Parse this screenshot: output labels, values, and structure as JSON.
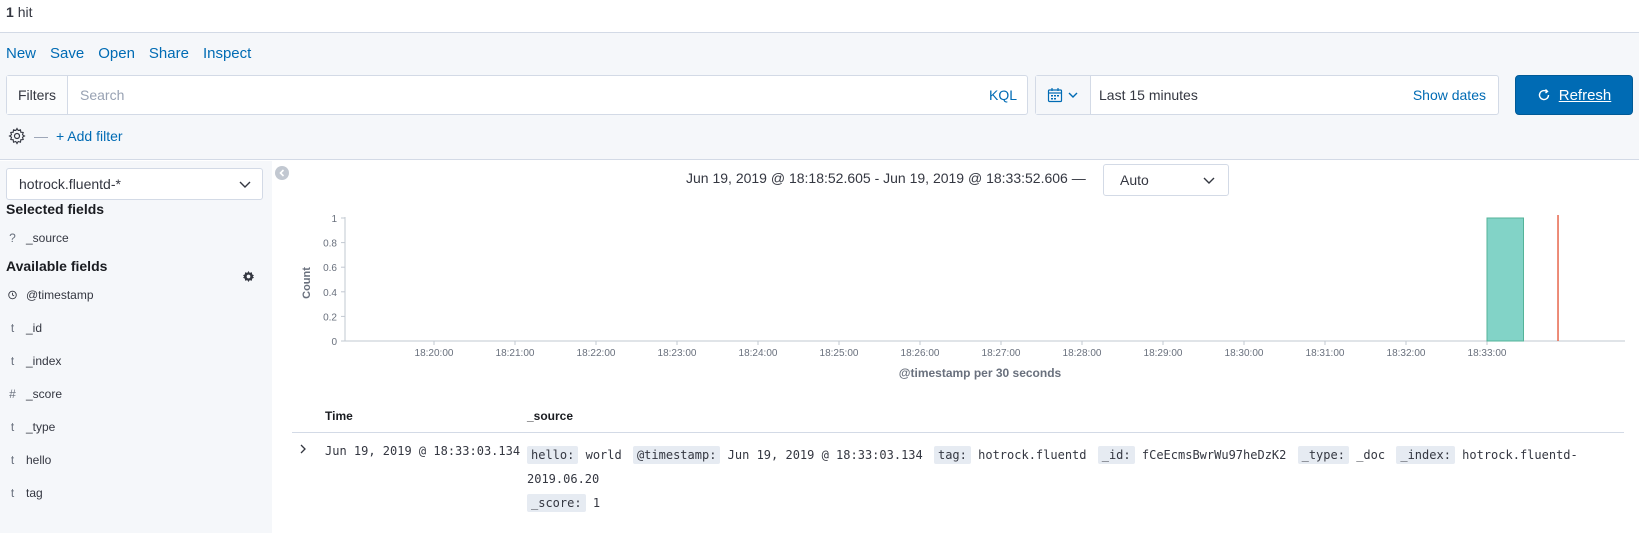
{
  "hits": {
    "count": "1",
    "label": "hit"
  },
  "menu": [
    "New",
    "Save",
    "Open",
    "Share",
    "Inspect"
  ],
  "query": {
    "filters_label": "Filters",
    "placeholder": "Search",
    "language": "KQL"
  },
  "time": {
    "label": "Last 15 minutes",
    "show_dates": "Show dates",
    "refresh": "Refresh"
  },
  "filter_bar": {
    "add_filter": "+ Add filter"
  },
  "sidebar": {
    "index_pattern": "hotrock.fluentd-*",
    "selected_title": "Selected fields",
    "selected_fields": [
      {
        "type": "?",
        "name": "_source"
      }
    ],
    "available_title": "Available fields",
    "available_fields": [
      {
        "type": "clock",
        "name": "@timestamp"
      },
      {
        "type": "t",
        "name": "_id"
      },
      {
        "type": "t",
        "name": "_index"
      },
      {
        "type": "#",
        "name": "_score"
      },
      {
        "type": "t",
        "name": "_type"
      },
      {
        "type": "t",
        "name": "hello"
      },
      {
        "type": "t",
        "name": "tag"
      }
    ]
  },
  "histogram": {
    "range_text": "Jun 19, 2019 @ 18:18:52.605 - Jun 19, 2019 @ 18:33:52.606 —",
    "interval": "Auto"
  },
  "chart_data": {
    "type": "bar",
    "xlabel": "@timestamp per 30 seconds",
    "ylabel": "Count",
    "ylim": [
      0,
      1
    ],
    "yticks": [
      "0",
      "0.2",
      "0.4",
      "0.6",
      "0.8",
      "1"
    ],
    "xticks": [
      "18:20:00",
      "18:21:00",
      "18:22:00",
      "18:23:00",
      "18:24:00",
      "18:25:00",
      "18:26:00",
      "18:27:00",
      "18:28:00",
      "18:29:00",
      "18:30:00",
      "18:31:00",
      "18:32:00",
      "18:33:00"
    ],
    "bars": [
      {
        "x": "18:33:00",
        "value": 1
      }
    ],
    "color": "#82d3c7",
    "now_marker_color": "#e7664c"
  },
  "table": {
    "headers": [
      "Time",
      "_source"
    ],
    "rows": [
      {
        "time": "Jun 19, 2019 @ 18:33:03.134",
        "source": [
          {
            "k": "hello:",
            "v": "world"
          },
          {
            "k": "@timestamp:",
            "v": "Jun 19, 2019 @ 18:33:03.134"
          },
          {
            "k": "tag:",
            "v": "hotrock.fluentd"
          },
          {
            "k": "_id:",
            "v": "fCeEcmsBwrWu97heDzK2"
          },
          {
            "k": "_type:",
            "v": "_doc"
          },
          {
            "k": "_index:",
            "v": "hotrock.fluentd-2019.06.20"
          },
          {
            "k": "_score:",
            "v": "1"
          }
        ]
      }
    ]
  }
}
